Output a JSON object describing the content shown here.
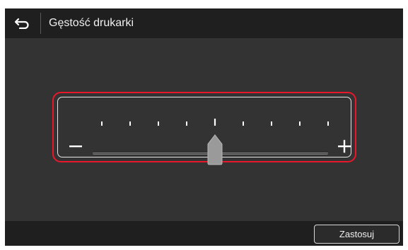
{
  "header": {
    "back_icon": "back-arrow-icon",
    "title": "Gęstość drukarki"
  },
  "slider": {
    "min_icon": "minus-icon",
    "max_icon": "plus-icon",
    "tick_count": 9,
    "selected_index": 4,
    "value_fraction": 0.5,
    "highlight_color": "#e8182a"
  },
  "footer": {
    "apply_label": "Zastosuj"
  }
}
